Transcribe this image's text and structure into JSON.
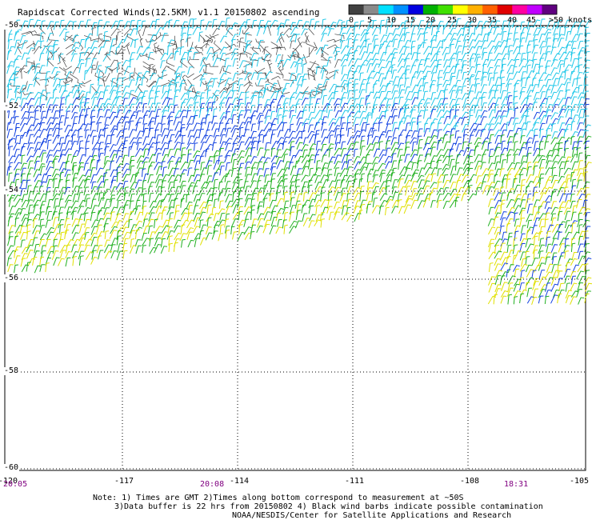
{
  "title": "Rapidscat Corrected Winds(12.5KM) v1.1 20150802 ascending",
  "legend": {
    "labels": [
      "0",
      "5",
      "10",
      "15",
      "20",
      "25",
      "30",
      "35",
      "40",
      "45",
      ">50 knots"
    ],
    "colors": [
      "#404040",
      "#8a8a8a",
      "#00e0ff",
      "#0090ff",
      "#0000e0",
      "#00b000",
      "#40e000",
      "#ffff00",
      "#ffb000",
      "#ff6000",
      "#e00000",
      "#ff00a0",
      "#c000ff",
      "#600080"
    ]
  },
  "lat_labels": [
    "-50",
    "-52",
    "-54",
    "-56",
    "-58",
    "-60"
  ],
  "lon_labels": [
    "-120",
    "-117",
    "-114",
    "-111",
    "-108",
    "-105"
  ],
  "time_labels": [
    "20:05",
    "20:08",
    "18:31"
  ],
  "notes": {
    "line1": "Note: 1) Times are GMT 2)Times along bottom correspond to measurement at ~50S",
    "line2": "3)Data buffer is 22 hrs from 20150802 4) Black wind barbs indicate possible contamination",
    "line3": "NOAA/NESDIS/Center for Satellite Applications and Research"
  },
  "bands": {
    "gray": "#404040",
    "cyan": "#20c8e8",
    "blue": "#1040e0",
    "green": "#20b020",
    "yellow": "#e0e000"
  }
}
